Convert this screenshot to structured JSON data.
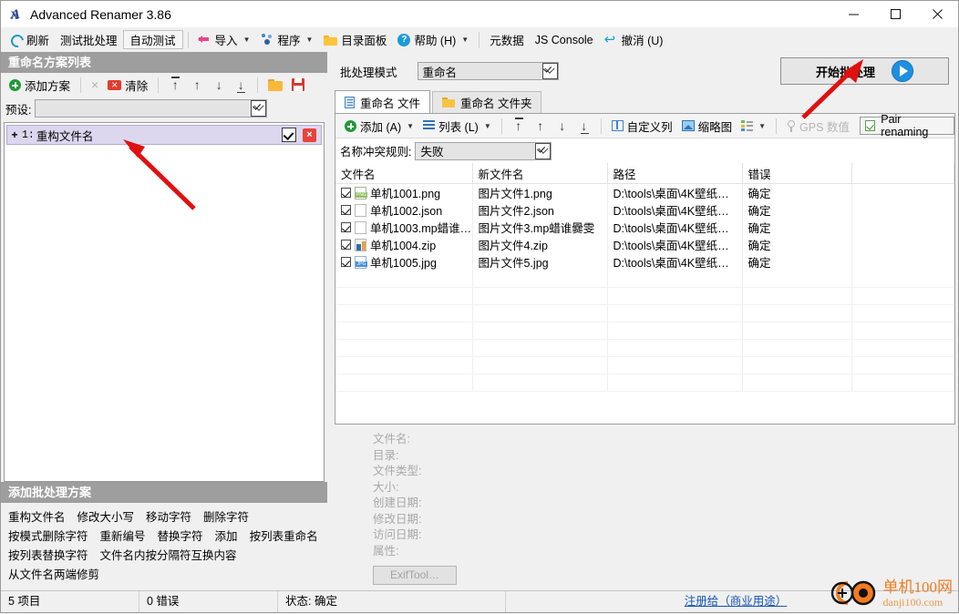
{
  "window": {
    "title": "Advanced Renamer 3.86",
    "app_icon": "app-logo-icon",
    "minimize": "—",
    "maximize": "□",
    "close": "✕"
  },
  "menubar": [
    {
      "label": "刷新",
      "icon": "refresh-icon",
      "caret": false,
      "boxed": false
    },
    {
      "label": "测试批处理",
      "icon": "",
      "caret": false,
      "boxed": false
    },
    {
      "label": "自动测试",
      "icon": "",
      "caret": false,
      "boxed": true
    },
    {
      "sep": true
    },
    {
      "label": "导入",
      "icon": "import-icon",
      "caret": true,
      "boxed": false
    },
    {
      "label": "程序",
      "icon": "program-icon",
      "caret": true,
      "boxed": false
    },
    {
      "label": "目录面板",
      "icon": "folder-icon",
      "caret": false,
      "boxed": false
    },
    {
      "label": "帮助 (H)",
      "icon": "help-icon",
      "caret": true,
      "boxed": false
    },
    {
      "sep": true
    },
    {
      "label": "元数据",
      "icon": "",
      "caret": false,
      "boxed": false
    },
    {
      "label": "JS Console",
      "icon": "",
      "caret": false,
      "boxed": false
    },
    {
      "label": "撤消 (U)",
      "icon": "undo-icon",
      "caret": false,
      "boxed": false
    }
  ],
  "left_panel": {
    "header": "重命名方案列表",
    "toolbar": {
      "add_method": "添加方案",
      "remove": "×",
      "clear": "清除",
      "move_top": "↑",
      "move_up": "↑",
      "move_down": "↓",
      "move_bottom": "↓",
      "open": "open-folder-icon",
      "save": "save-icon"
    },
    "preset": {
      "label": "预设:",
      "value": "",
      "placeholder": ""
    },
    "schemes": [
      {
        "index": "1:",
        "plus": "+",
        "label": "重构文件名",
        "enabled": true,
        "delete": "×"
      }
    ],
    "methods_header": "添加批处理方案",
    "methods_rows": [
      [
        "重构文件名",
        "修改大小写",
        "移动字符",
        "删除字符"
      ],
      [
        "按模式删除字符",
        "重新编号",
        "替换字符",
        "添加",
        "按列表重命名"
      ],
      [
        "按列表替换字符",
        "文件名内按分隔符互换内容"
      ],
      [
        "从文件名两端修剪"
      ]
    ]
  },
  "right_panel": {
    "mode_label": "批处理模式",
    "mode_value": "重命名",
    "start_button": "开始批处理",
    "tabs": [
      {
        "label": "重命名 文件",
        "icon": "document-icon",
        "active": true
      },
      {
        "label": "重命名 文件夹",
        "icon": "folder-icon",
        "active": false
      }
    ],
    "file_toolbar": {
      "add": "添加 (A)",
      "list": "列表 (L)",
      "move_top": "↑",
      "move_up": "↑",
      "move_down": "↓",
      "move_bottom": "↓",
      "custom_columns": "自定义列",
      "thumbnail": "缩略图",
      "view_modes": "view-list-icon",
      "gps_values": "GPS 数值",
      "pair_renaming": "Pair renaming"
    },
    "conflict": {
      "label": "名称冲突规则:",
      "value": "失败"
    },
    "table": {
      "columns": [
        "文件名",
        "新文件名",
        "路径",
        "错误",
        ""
      ],
      "rows": [
        {
          "checked": true,
          "icon": "png-file-icon",
          "name": "单机1001.png",
          "new_name": "图片文件1.png",
          "path": "D:\\tools\\桌面\\4K壁纸…",
          "error": "确定"
        },
        {
          "checked": true,
          "icon": "blank-file-icon",
          "name": "单机1002.json",
          "new_name": "图片文件2.json",
          "path": "D:\\tools\\桌面\\4K壁纸…",
          "error": "确定"
        },
        {
          "checked": true,
          "icon": "blank-file-icon",
          "name": "单机1003.mp蜡谁…",
          "new_name": "图片文件3.mp蜡谁爨雯",
          "path": "D:\\tools\\桌面\\4K壁纸…",
          "error": "确定"
        },
        {
          "checked": true,
          "icon": "zip-file-icon",
          "name": "单机1004.zip",
          "new_name": "图片文件4.zip",
          "path": "D:\\tools\\桌面\\4K壁纸…",
          "error": "确定"
        },
        {
          "checked": true,
          "icon": "jpg-file-icon",
          "name": "单机1005.jpg",
          "new_name": "图片文件5.jpg",
          "path": "D:\\tools\\桌面\\4K壁纸…",
          "error": "确定"
        }
      ]
    },
    "details": {
      "fields": [
        "文件名:",
        "目录:",
        "文件类型:",
        "大小:",
        "创建日期:",
        "修改日期:",
        "访问日期:",
        "属性:"
      ],
      "exif_button": "ExifTool…"
    }
  },
  "status_bar": {
    "items": "5 项目",
    "errors": "0 错误",
    "state": "状态: 确定",
    "register_link": "注册给（商业用途）"
  },
  "watermark": {
    "line1": "单机100网",
    "line2": "danji100.com"
  },
  "colors": {
    "accent_blue": "#1f8fe0",
    "header_grey": "#9e9e9e",
    "scheme_row": "#dcd7ee",
    "arrow_red": "#e01010",
    "link_blue": "#1554b5",
    "watermark_orange": "#f07a22"
  }
}
